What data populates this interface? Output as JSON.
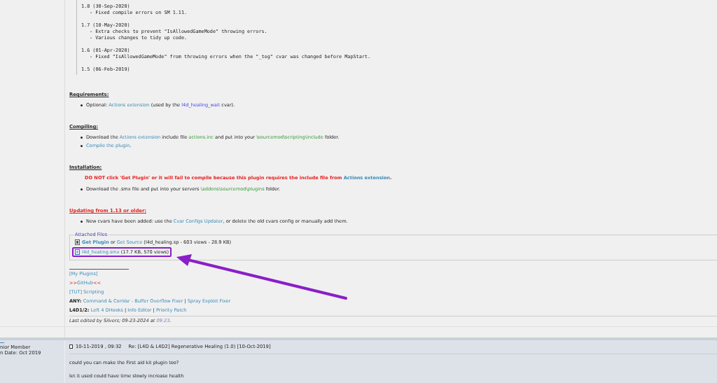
{
  "changelog": [
    {
      "kind": "version",
      "text": "1.8 (30-Sep-2020)"
    },
    {
      "kind": "note",
      "text": "- Fixed compile errors on SM 1.11."
    },
    {
      "kind": "version",
      "text": "1.7 (10-May-2020)"
    },
    {
      "kind": "note",
      "text": "- Extra checks to prevent \"IsAllowedGameMode\" throwing errors."
    },
    {
      "kind": "note",
      "text": "- Various changes to tidy up code."
    },
    {
      "kind": "version",
      "text": "1.6 (01-Apr-2020)"
    },
    {
      "kind": "note",
      "text": "- Fixed \"IsAllowedGameMode\" from throwing errors when the \"_tog\" cvar was changed before MapStart."
    },
    {
      "kind": "version",
      "text": "1.5 (06-Feb-2019)"
    }
  ],
  "sections": [
    {
      "heading": "Requirements:",
      "alert": false,
      "items": [
        {
          "kind": "bullet",
          "segments": [
            {
              "kind": "text",
              "text": "Optional: "
            },
            {
              "kind": "link",
              "text": "Actions extension"
            },
            {
              "kind": "text",
              "text": " (used by the "
            },
            {
              "kind": "var",
              "text": "l4d_healing_wait"
            },
            {
              "kind": "text",
              "text": " cvar)."
            }
          ]
        }
      ]
    },
    {
      "heading": "Compiling:",
      "alert": false,
      "items": [
        {
          "kind": "bullet",
          "segments": [
            {
              "kind": "text",
              "text": "Download the "
            },
            {
              "kind": "link",
              "text": "Actions extension"
            },
            {
              "kind": "text",
              "text": " include file "
            },
            {
              "kind": "path",
              "text": "actions.inc"
            },
            {
              "kind": "text",
              "text": " and put into your "
            },
            {
              "kind": "path",
              "text": "\\sourcemod\\scripting\\include"
            },
            {
              "kind": "text",
              "text": " folder."
            }
          ]
        },
        {
          "kind": "bullet",
          "segments": [
            {
              "kind": "link",
              "text": "Compile the plugin"
            },
            {
              "kind": "text",
              "text": "."
            }
          ]
        }
      ]
    },
    {
      "heading": "Installation:",
      "alert": false,
      "items": [
        {
          "kind": "warning",
          "segments": [
            {
              "kind": "alert",
              "text": "DO NOT click 'Get Plugin' or it will fail to compile because this plugin requires the include file from "
            },
            {
              "kind": "link",
              "text": "Actions extension"
            },
            {
              "kind": "alert",
              "text": "."
            }
          ]
        },
        {
          "kind": "bullet",
          "segments": [
            {
              "kind": "text",
              "text": "Download the .smx file and put into your servers "
            },
            {
              "kind": "path",
              "text": "\\addons\\sourcemod\\plugins"
            },
            {
              "kind": "text",
              "text": " folder."
            }
          ]
        }
      ]
    },
    {
      "heading": "Updating from 1.13 or older:",
      "alert": true,
      "items": [
        {
          "kind": "bullet",
          "segments": [
            {
              "kind": "text",
              "text": "New cvars have been added: use the "
            },
            {
              "kind": "link",
              "text": "Cvar Configs Updater"
            },
            {
              "kind": "text",
              "text": ", or delete the old cvars config or manually add them."
            }
          ]
        }
      ]
    }
  ],
  "attached_files": {
    "legend": "Attached Files",
    "files": [
      {
        "kind": "source",
        "highlighted": false,
        "segments": [
          {
            "kind": "strong-link",
            "text": "Get Plugin"
          },
          {
            "kind": "text",
            "text": " or "
          },
          {
            "kind": "link",
            "text": "Get Source"
          },
          {
            "kind": "text",
            "text": " (l4d_healing.sp - 603 views - 28.9 KB)"
          }
        ]
      },
      {
        "kind": "binary",
        "highlighted": true,
        "segments": [
          {
            "kind": "link",
            "text": "l4d_healing.smx"
          },
          {
            "kind": "text",
            "text": " (17.7 KB, 570 views)"
          }
        ]
      }
    ]
  },
  "signature": [
    [
      {
        "kind": "link",
        "text": "[My Plugins]"
      }
    ],
    [
      {
        "kind": "alert",
        "text": ">>"
      },
      {
        "kind": "link",
        "text": "GitHub"
      },
      {
        "kind": "alert",
        "text": "<<"
      }
    ],
    [
      {
        "kind": "link",
        "text": "[TUT] Scripting"
      }
    ],
    [
      {
        "kind": "bold",
        "text": "ANY: "
      },
      {
        "kind": "link",
        "text": "Command & ConVar - Buffer Overflow Fixer"
      },
      {
        "kind": "text",
        "text": " | "
      },
      {
        "kind": "link",
        "text": "Spray Exploit Fixer"
      }
    ],
    [
      {
        "kind": "bold",
        "text": "L4D1/2: "
      },
      {
        "kind": "link",
        "text": "Left 4 DHooks"
      },
      {
        "kind": "text",
        "text": " | "
      },
      {
        "kind": "link",
        "text": "Info Editor"
      },
      {
        "kind": "text",
        "text": " | "
      },
      {
        "kind": "link",
        "text": "Priority Patch"
      }
    ]
  ],
  "last_edited": {
    "text": "Last edited by Silvers; 09-23-2024 at ",
    "time": "09:23",
    "end": "."
  },
  "next_post": {
    "user_title": "nior Member",
    "join_date": "n Date: Oct 2019",
    "date": "10-11-2019 , 09:32",
    "title": "Re: [L4D & L4D2] Regenerative Healing (1.0) [10-Oct-2019]",
    "paragraphs": [
      "could you can make the First aid kit plugin too?",
      "let it used could have time slowly increase health"
    ]
  }
}
